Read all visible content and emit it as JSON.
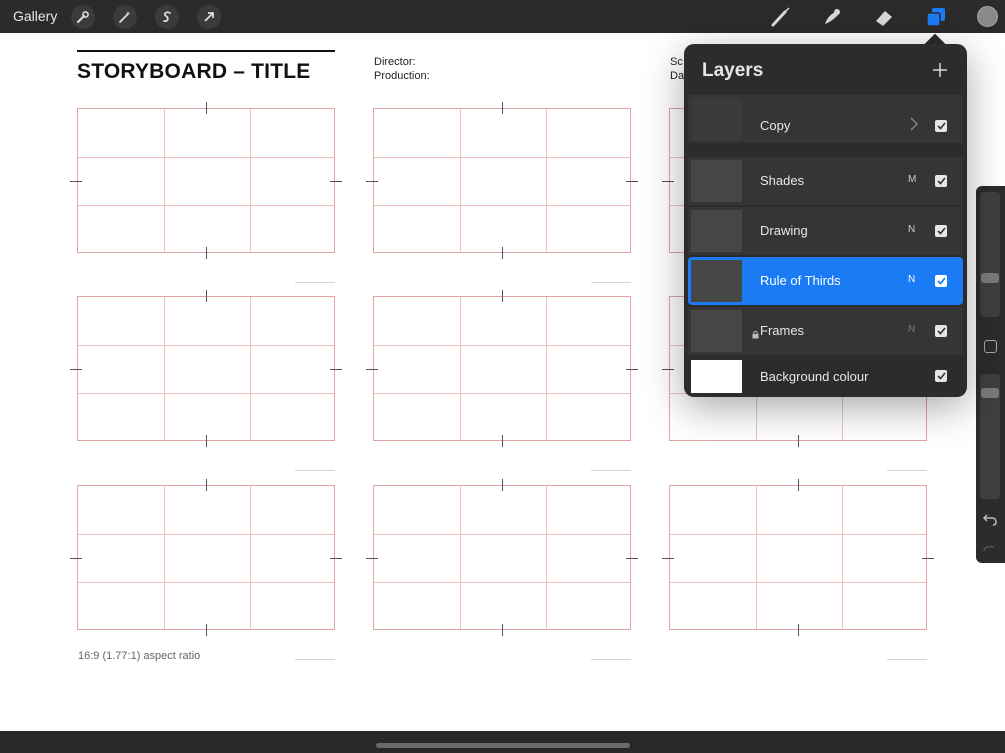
{
  "topbar": {
    "gallery_label": "Gallery",
    "left_tools": [
      "wrench-icon",
      "magic-wand-icon",
      "selection-s-icon",
      "transform-arrow-icon"
    ],
    "right_tools": [
      "brush-icon",
      "smudge-icon",
      "eraser-icon",
      "layers-icon"
    ],
    "accent_color": "#1a7bf4"
  },
  "document": {
    "title": "STORYBOARD – TITLE",
    "director_label": "Director:",
    "production_label": "Production:",
    "scene_label_partial": "Sc",
    "date_label_partial": "Da",
    "aspect_note": "16:9 (1.77:1) aspect ratio",
    "frame_line_color": "#e2a3a3"
  },
  "layers_panel": {
    "title": "Layers",
    "add_icon": "plus-icon",
    "layers": [
      {
        "name": "Copy",
        "blend": "",
        "visible": true,
        "group": true
      },
      {
        "name": "Shades",
        "blend": "M",
        "visible": true
      },
      {
        "name": "Drawing",
        "blend": "N",
        "visible": true
      },
      {
        "name": "Rule of Thirds",
        "blend": "N",
        "visible": true,
        "selected": true
      },
      {
        "name": "Frames",
        "blend": "N",
        "visible": true,
        "locked": true
      },
      {
        "name": "Background colour",
        "blend": "",
        "visible": true
      }
    ]
  },
  "sidebar": {
    "brush_size_level": 0.3,
    "opacity_level": 0.88,
    "undo_icon": "undo-icon",
    "redo_icon": "redo-icon"
  }
}
